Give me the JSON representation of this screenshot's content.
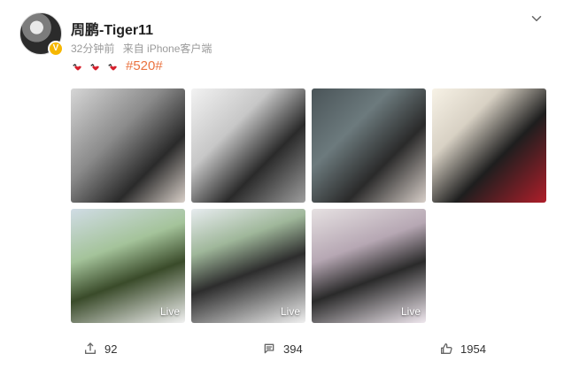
{
  "post": {
    "author": {
      "name": "周鹏-Tiger11",
      "verified_badge": "V"
    },
    "meta": {
      "time": "32分钟前",
      "source": "来自 iPhone客户端"
    },
    "text": {
      "emojis": [
        "kiss-emoji",
        "kiss-emoji",
        "kiss-emoji"
      ],
      "hashtag": "#520#"
    },
    "photos": [
      {
        "label": ""
      },
      {
        "label": ""
      },
      {
        "label": ""
      },
      {
        "label": ""
      },
      {
        "label": "Live"
      },
      {
        "label": "Live"
      },
      {
        "label": "Live"
      }
    ],
    "actions": {
      "share_count": "92",
      "comment_count": "394",
      "like_count": "1954"
    }
  }
}
